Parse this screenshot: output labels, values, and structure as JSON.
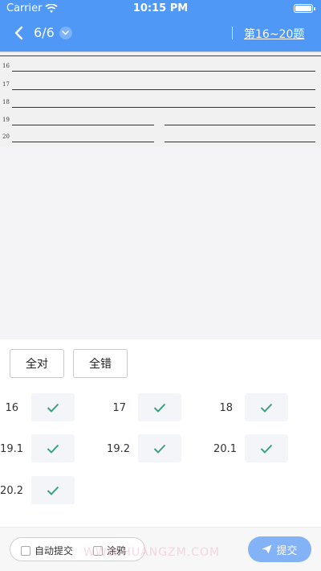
{
  "status_bar": {
    "carrier": "Carrier",
    "time": "10:15 PM"
  },
  "nav": {
    "page_indicator": "6/6",
    "question_range": "第16~20题"
  },
  "sheet": {
    "rows": [
      "16",
      "17",
      "18",
      "19",
      "20"
    ]
  },
  "grading": {
    "all_correct_label": "全对",
    "all_wrong_label": "全错",
    "items": [
      {
        "label": "16",
        "mark": "correct"
      },
      {
        "label": "17",
        "mark": "correct"
      },
      {
        "label": "18",
        "mark": "correct"
      },
      {
        "label": "19.1",
        "mark": "correct"
      },
      {
        "label": "19.2",
        "mark": "correct"
      },
      {
        "label": "20.1",
        "mark": "correct"
      },
      {
        "label": "20.2",
        "mark": "correct"
      }
    ]
  },
  "bottom": {
    "auto_submit_label": "自动提交",
    "doodle_label": "涂鸦",
    "watermark": "WWW.HUANGZM.COM",
    "submit_label": "提交"
  },
  "colors": {
    "primary": "#4f98f6",
    "check": "#3aa17e",
    "submit": "#83b2f7"
  }
}
